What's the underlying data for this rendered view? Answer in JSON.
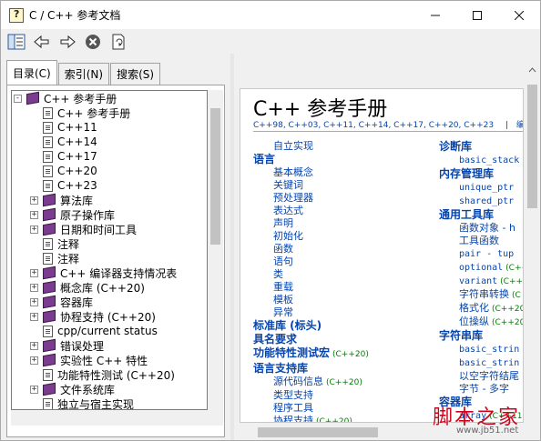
{
  "window": {
    "title": "C / C++ 参考文档"
  },
  "tabs": [
    {
      "label": "目录(C)",
      "active": true
    },
    {
      "label": "索引(N)",
      "active": false
    },
    {
      "label": "搜索(S)",
      "active": false
    }
  ],
  "tree": [
    {
      "label": "C++ 参考手册",
      "icon": "open-book",
      "exp": "-",
      "level": 0
    },
    {
      "label": "C++ 参考手册",
      "icon": "page",
      "level": 1
    },
    {
      "label": "C++11",
      "icon": "page",
      "level": 1
    },
    {
      "label": "C++14",
      "icon": "page",
      "level": 1
    },
    {
      "label": "C++17",
      "icon": "page",
      "level": 1
    },
    {
      "label": "C++20",
      "icon": "page",
      "level": 1
    },
    {
      "label": "C++23",
      "icon": "page",
      "level": 1
    },
    {
      "label": "算法库",
      "icon": "book",
      "exp": "+",
      "level": 1
    },
    {
      "label": "原子操作库",
      "icon": "book",
      "exp": "+",
      "level": 1
    },
    {
      "label": "日期和时间工具",
      "icon": "book",
      "exp": "+",
      "level": 1
    },
    {
      "label": "注释",
      "icon": "page",
      "level": 1
    },
    {
      "label": "注释",
      "icon": "page",
      "level": 1
    },
    {
      "label": "C++ 编译器支持情况表",
      "icon": "book",
      "exp": "+",
      "level": 1
    },
    {
      "label": "概念库 (C++20)",
      "icon": "book",
      "exp": "+",
      "level": 1
    },
    {
      "label": "容器库",
      "icon": "book",
      "exp": "+",
      "level": 1
    },
    {
      "label": "协程支持 (C++20)",
      "icon": "book",
      "exp": "+",
      "level": 1
    },
    {
      "label": "cpp/current status",
      "icon": "page",
      "level": 1
    },
    {
      "label": "错误处理",
      "icon": "book",
      "exp": "+",
      "level": 1
    },
    {
      "label": "实验性 C++ 特性",
      "icon": "book",
      "exp": "+",
      "level": 1
    },
    {
      "label": "功能特性测试 (C++20)",
      "icon": "page",
      "level": 1
    },
    {
      "label": "文件系统库",
      "icon": "book",
      "exp": "+",
      "level": 1
    },
    {
      "label": "独立与宿主实现",
      "icon": "page",
      "level": 1
    }
  ],
  "page": {
    "title": "C++ 参考手册",
    "versions": "C++98, C++03, C++11, C++14, C++17, C++20, C++23",
    "edit": "编译",
    "col1": [
      {
        "type": "it",
        "text": "自立实现"
      },
      {
        "type": "hd",
        "text": "语言"
      },
      {
        "type": "it",
        "text": "基本概念"
      },
      {
        "type": "it",
        "text": "关键词"
      },
      {
        "type": "it",
        "text": "预处理器"
      },
      {
        "type": "it",
        "text": "表达式"
      },
      {
        "type": "it",
        "text": "声明"
      },
      {
        "type": "it",
        "text": "初始化"
      },
      {
        "type": "it",
        "text": "函数"
      },
      {
        "type": "it",
        "text": "语句"
      },
      {
        "type": "it",
        "text": "类"
      },
      {
        "type": "it",
        "text": "重载"
      },
      {
        "type": "it",
        "text": "模板"
      },
      {
        "type": "it",
        "text": "异常"
      },
      {
        "type": "hd",
        "text": "标准库 (标头)"
      },
      {
        "type": "hd",
        "text": "具名要求"
      },
      {
        "type": "hd",
        "text": "功能特性测试宏",
        "ver": "(C++20)"
      },
      {
        "type": "hd",
        "text": "语言支持库"
      },
      {
        "type": "it",
        "text": "源代码信息",
        "ver": "(C++20)"
      },
      {
        "type": "it",
        "text": "类型支持"
      },
      {
        "type": "it",
        "text": "程序工具"
      },
      {
        "type": "it",
        "text": "协程支持",
        "ver": "(C++20)"
      }
    ],
    "col2": [
      {
        "type": "hd",
        "text": "诊断库"
      },
      {
        "type": "it",
        "text": "basic_stack",
        "mono": true
      },
      {
        "type": "hd",
        "text": "内存管理库"
      },
      {
        "type": "it",
        "text": "unique_ptr",
        "mono": true
      },
      {
        "type": "it",
        "text": "shared_ptr",
        "mono": true
      },
      {
        "type": "hd",
        "text": "通用工具库"
      },
      {
        "type": "it",
        "text": "函数对象 - h"
      },
      {
        "type": "it",
        "text": "工具函数"
      },
      {
        "type": "it",
        "text": "pair - tup",
        "mono": true
      },
      {
        "type": "it",
        "text": "optional",
        "mono": true,
        "ver": "(C++"
      },
      {
        "type": "it",
        "text": "variant",
        "mono": true,
        "ver": "(C++"
      },
      {
        "type": "it",
        "text": "字符串转换",
        "ver": "(C"
      },
      {
        "type": "it",
        "text": "格式化",
        "ver": "(C++20)"
      },
      {
        "type": "it",
        "text": "位操纵",
        "ver": "(C++20)"
      },
      {
        "type": "hd",
        "text": "字符串库"
      },
      {
        "type": "it",
        "text": "basic_strin",
        "mono": true
      },
      {
        "type": "it",
        "text": "basic_strin",
        "mono": true
      },
      {
        "type": "it",
        "text": "以空字符结尾"
      },
      {
        "type": "it",
        "text": "字节 - 多字"
      },
      {
        "type": "hd",
        "text": "容器库"
      },
      {
        "type": "it",
        "text": "array",
        "mono": true,
        "ver": "(C++11)"
      },
      {
        "type": "it",
        "text": "list - fo",
        "mono": true
      }
    ]
  },
  "watermark": {
    "main": "脚本之家",
    "sub": "www.jb51.net"
  }
}
